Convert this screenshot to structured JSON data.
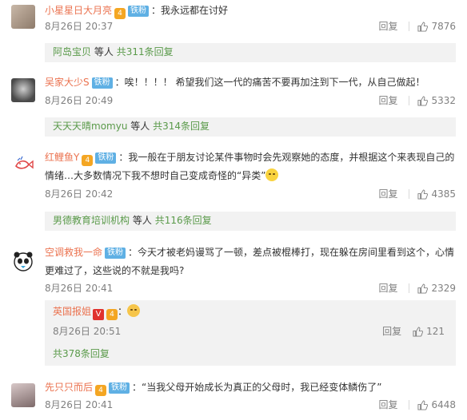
{
  "comments": [
    {
      "user": "小星星日大月亮",
      "badge": "铁粉",
      "text": "我永远都在讨好",
      "time": "8月26日 20:37",
      "reply": "回复",
      "likes": "7876",
      "sub": {
        "user": "阿岛宝贝",
        "suffix": "等人",
        "count": "共311条回复"
      }
    },
    {
      "user": "吴家大少S",
      "badge": "铁粉",
      "text": "唉！！！！ 希望我们这一代的痛苦不要再加注到下一代，从自己做起！",
      "time": "8月26日 20:49",
      "reply": "回复",
      "likes": "5332",
      "sub": {
        "user": "天天天晴momyu",
        "suffix": "等人",
        "count": "共314条回复"
      }
    },
    {
      "user": "红鲤鱼Y",
      "badge": "铁粉",
      "text1": "我一般在于朋友讨论某件事物时会先观察她的态度，并根据这个来表现自己的",
      "text2": "情绪…大多数情况下我不想时自己变成奇怪的“异类”",
      "time": "8月26日 20:42",
      "reply": "回复",
      "likes": "4385",
      "sub": {
        "user": "男德教育培训机构",
        "suffix": "等人",
        "count": "共116条回复"
      }
    },
    {
      "user": "空调救我一命",
      "badge": "铁粉",
      "text1": "今天才被老妈谩骂了一顿，差点被棍棒打，现在躲在房间里看到这个，心情",
      "text2": "更难过了，这些说的不就是我吗?",
      "time": "8月26日 20:41",
      "reply": "回复",
      "likes": "2329",
      "sub_reply": {
        "user": "英国报姐",
        "v": "V",
        "time": "8月26日 20:51",
        "reply": "回复",
        "likes": "121",
        "count": "共378条回复"
      }
    },
    {
      "user": "先只只而后",
      "badge": "铁粉",
      "text": "“当我父母开始成长为真正的父母时，我已经变体鳞伤了”",
      "time": "8月26日 20:41",
      "reply": "回复",
      "likes": "6448"
    }
  ],
  "colors": {
    "username": "#eb7350",
    "green_link": "#5a9a4a",
    "badge": "#5fb0e4"
  },
  "icons": [
    "avatar",
    "level-icon",
    "thumb-up-icon",
    "blush-emoji",
    "v-badge-icon"
  ]
}
